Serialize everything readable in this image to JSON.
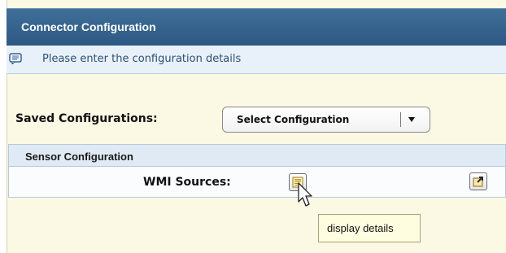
{
  "window": {
    "title": "Connector Configuration"
  },
  "info_bar": {
    "message": "Please enter the configuration details",
    "icon": "info-message-icon"
  },
  "saved_configurations": {
    "label": "Saved Configurations:",
    "selected_value": "Select Configuration",
    "arrow_icon": "dropdown-arrow-icon"
  },
  "sensor_configuration": {
    "title": "Sensor Configuration",
    "wmi_sources_label": "WMI Sources:",
    "details_icon": "display-details-icon",
    "export_icon": "export-icon"
  },
  "tooltip": {
    "text": "display details"
  },
  "colors": {
    "title_bar": "#2d5883",
    "info_bar_bg": "#e8f1fa",
    "page_bg": "#fbf8e4",
    "section_header_bg": "#dfeaf5",
    "tooltip_bg": "#fffde0"
  }
}
